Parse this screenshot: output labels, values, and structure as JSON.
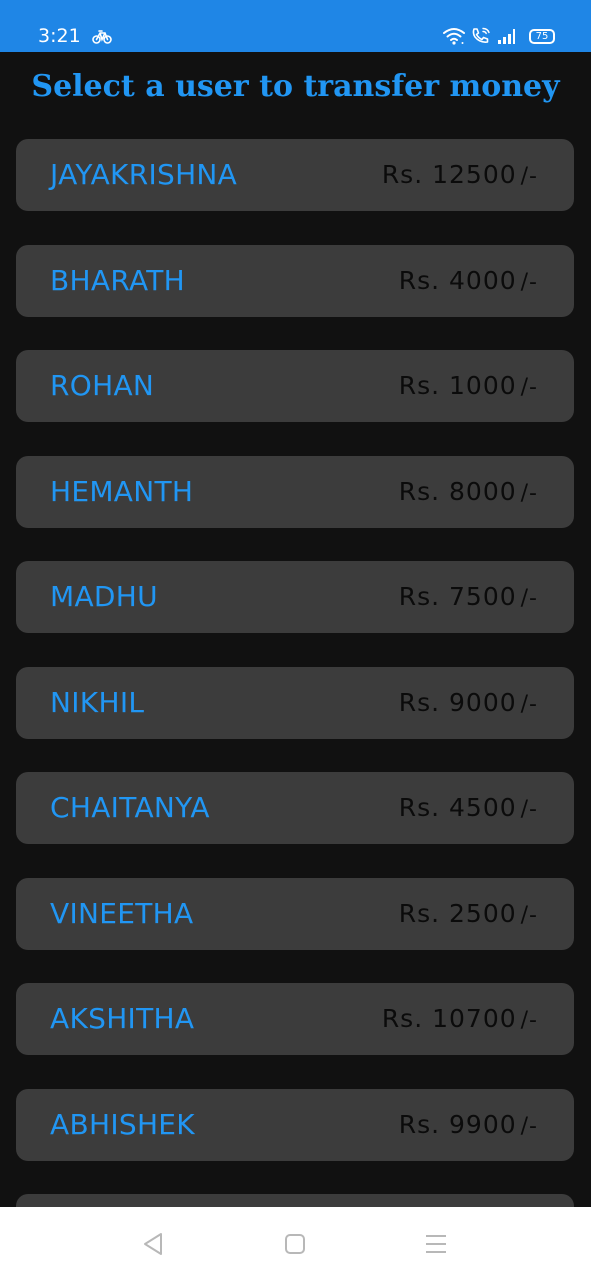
{
  "status_bar": {
    "time": "3:21",
    "battery_level": "75",
    "icons": [
      "bike-app-icon",
      "wifi-icon",
      "wifi-call-icon",
      "signal-icon",
      "battery-icon"
    ]
  },
  "page": {
    "title": "Select a user to transfer money"
  },
  "users": [
    {
      "name": "JAYAKRISHNA",
      "amount": "Rs. 12500",
      "suffix": "/-"
    },
    {
      "name": "BHARATH",
      "amount": "Rs. 4000",
      "suffix": "/-"
    },
    {
      "name": "ROHAN",
      "amount": "Rs. 1000",
      "suffix": "/-"
    },
    {
      "name": "HEMANTH",
      "amount": "Rs. 8000",
      "suffix": "/-"
    },
    {
      "name": "MADHU",
      "amount": "Rs. 7500",
      "suffix": "/-"
    },
    {
      "name": "NIKHIL",
      "amount": "Rs. 9000",
      "suffix": "/-"
    },
    {
      "name": "CHAITANYA",
      "amount": "Rs. 4500",
      "suffix": "/-"
    },
    {
      "name": "VINEETHA",
      "amount": "Rs. 2500",
      "suffix": "/-"
    },
    {
      "name": "AKSHITHA",
      "amount": "Rs. 10700",
      "suffix": "/-"
    },
    {
      "name": "ABHISHEK",
      "amount": "Rs. 9900",
      "suffix": "/-"
    }
  ],
  "nav_bar": {
    "icons": [
      "back-triangle-icon",
      "home-square-icon",
      "menu-lines-icon"
    ]
  },
  "colors": {
    "status_bar": "#1f86e6",
    "background": "#111111",
    "card": "#3c3c3c",
    "accent": "#2196f3",
    "balance_text": "#0b0b0b"
  }
}
